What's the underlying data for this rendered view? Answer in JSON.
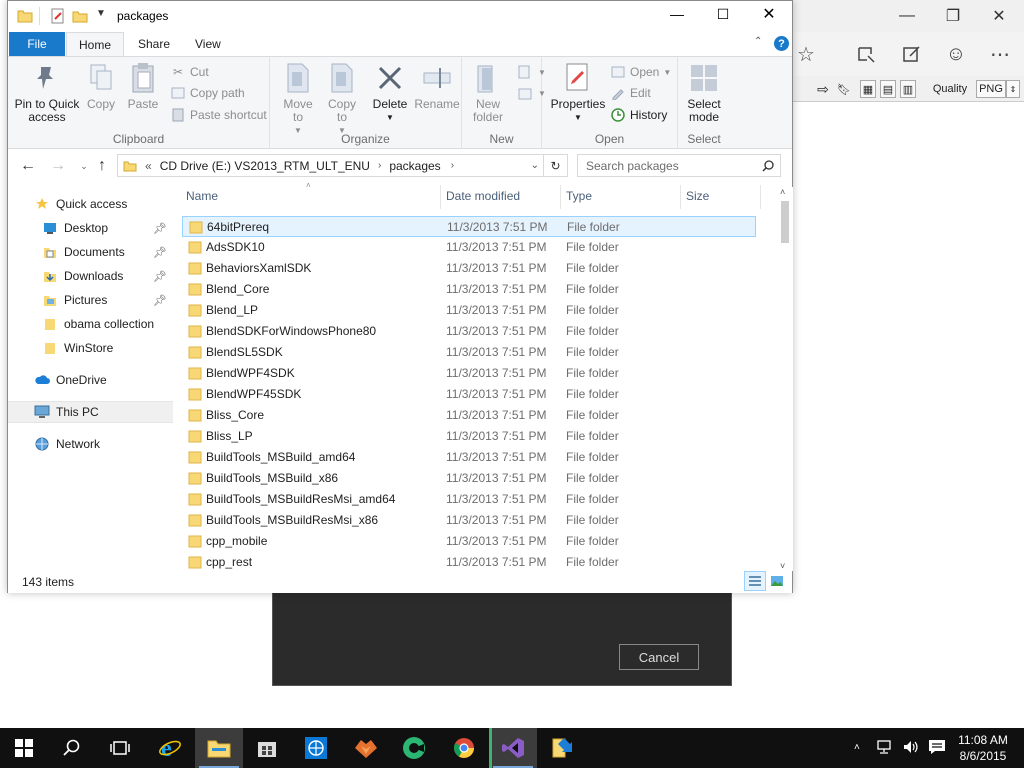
{
  "window": {
    "title": "packages",
    "controls": {
      "minimize": "—",
      "maximize": "☐",
      "close": "✕"
    }
  },
  "ribbon": {
    "tabs": [
      "File",
      "Home",
      "Share",
      "View"
    ],
    "clipboard": {
      "label": "Clipboard",
      "pin": "Pin to Quick access",
      "copy": "Copy",
      "paste": "Paste",
      "cut": "Cut",
      "copy_path": "Copy path",
      "paste_shortcut": "Paste shortcut"
    },
    "organize": {
      "label": "Organize",
      "move_to": "Move to",
      "copy_to": "Copy to",
      "delete": "Delete",
      "rename": "Rename"
    },
    "new": {
      "label": "New",
      "new_folder": "New folder"
    },
    "open": {
      "label": "Open",
      "properties": "Properties",
      "open": "Open",
      "edit": "Edit",
      "history": "History"
    },
    "select": {
      "label": "Select",
      "select_mode": "Select mode"
    }
  },
  "address": {
    "prefix": "«",
    "crumbs": [
      "CD Drive (E:) VS2013_RTM_ULT_ENU",
      "packages"
    ],
    "search_placeholder": "Search packages"
  },
  "nav": [
    {
      "label": "Quick access",
      "icon": "star-icon",
      "pinned": false
    },
    {
      "label": "Desktop",
      "icon": "desktop-icon",
      "pinned": true
    },
    {
      "label": "Documents",
      "icon": "documents-icon",
      "pinned": true
    },
    {
      "label": "Downloads",
      "icon": "downloads-icon",
      "pinned": true
    },
    {
      "label": "Pictures",
      "icon": "pictures-icon",
      "pinned": true
    },
    {
      "label": "obama collection",
      "icon": "folder-icon",
      "pinned": false
    },
    {
      "label": "WinStore",
      "icon": "folder-icon",
      "pinned": false
    },
    {
      "label": "OneDrive",
      "icon": "cloud-icon",
      "pinned": false
    },
    {
      "label": "This PC",
      "icon": "computer-icon",
      "pinned": false
    },
    {
      "label": "Network",
      "icon": "network-icon",
      "pinned": false
    }
  ],
  "columns": {
    "name": "Name",
    "date": "Date modified",
    "type": "Type",
    "size": "Size"
  },
  "files": [
    {
      "name": "64bitPrereq",
      "date": "11/3/2013 7:51 PM",
      "type": "File folder",
      "selected": true
    },
    {
      "name": "AdsSDK10",
      "date": "11/3/2013 7:51 PM",
      "type": "File folder"
    },
    {
      "name": "BehaviorsXamlSDK",
      "date": "11/3/2013 7:51 PM",
      "type": "File folder"
    },
    {
      "name": "Blend_Core",
      "date": "11/3/2013 7:51 PM",
      "type": "File folder"
    },
    {
      "name": "Blend_LP",
      "date": "11/3/2013 7:51 PM",
      "type": "File folder"
    },
    {
      "name": "BlendSDKForWindowsPhone80",
      "date": "11/3/2013 7:51 PM",
      "type": "File folder"
    },
    {
      "name": "BlendSL5SDK",
      "date": "11/3/2013 7:51 PM",
      "type": "File folder"
    },
    {
      "name": "BlendWPF4SDK",
      "date": "11/3/2013 7:51 PM",
      "type": "File folder"
    },
    {
      "name": "BlendWPF45SDK",
      "date": "11/3/2013 7:51 PM",
      "type": "File folder"
    },
    {
      "name": "Bliss_Core",
      "date": "11/3/2013 7:51 PM",
      "type": "File folder"
    },
    {
      "name": "Bliss_LP",
      "date": "11/3/2013 7:51 PM",
      "type": "File folder"
    },
    {
      "name": "BuildTools_MSBuild_amd64",
      "date": "11/3/2013 7:51 PM",
      "type": "File folder"
    },
    {
      "name": "BuildTools_MSBuild_x86",
      "date": "11/3/2013 7:51 PM",
      "type": "File folder"
    },
    {
      "name": "BuildTools_MSBuildResMsi_amd64",
      "date": "11/3/2013 7:51 PM",
      "type": "File folder"
    },
    {
      "name": "BuildTools_MSBuildResMsi_x86",
      "date": "11/3/2013 7:51 PM",
      "type": "File folder"
    },
    {
      "name": "cpp_mobile",
      "date": "11/3/2013 7:51 PM",
      "type": "File folder"
    },
    {
      "name": "cpp_rest",
      "date": "11/3/2013 7:51 PM",
      "type": "File folder"
    }
  ],
  "status": {
    "item_count": "143 items"
  },
  "background_app": {
    "quality_label": "Quality",
    "format_value": "PNG"
  },
  "dialog": {
    "cancel": "Cancel"
  },
  "taskbar": {
    "time": "11:08 AM",
    "date": "8/6/2015",
    "apps": [
      "start-icon",
      "search-icon",
      "task-view-icon",
      "edge-icon",
      "file-explorer-icon",
      "store-icon",
      "ie-globe-icon",
      "firefox-icon",
      "camtasia-icon",
      "chrome-icon",
      "visual-studio-icon",
      "setup-icon"
    ]
  },
  "colors": {
    "accent": "#1979ca",
    "folder": "#f8d775",
    "selection": "#e5f3ff",
    "selection_border": "#99d1ff",
    "taskbar": "#101010"
  }
}
